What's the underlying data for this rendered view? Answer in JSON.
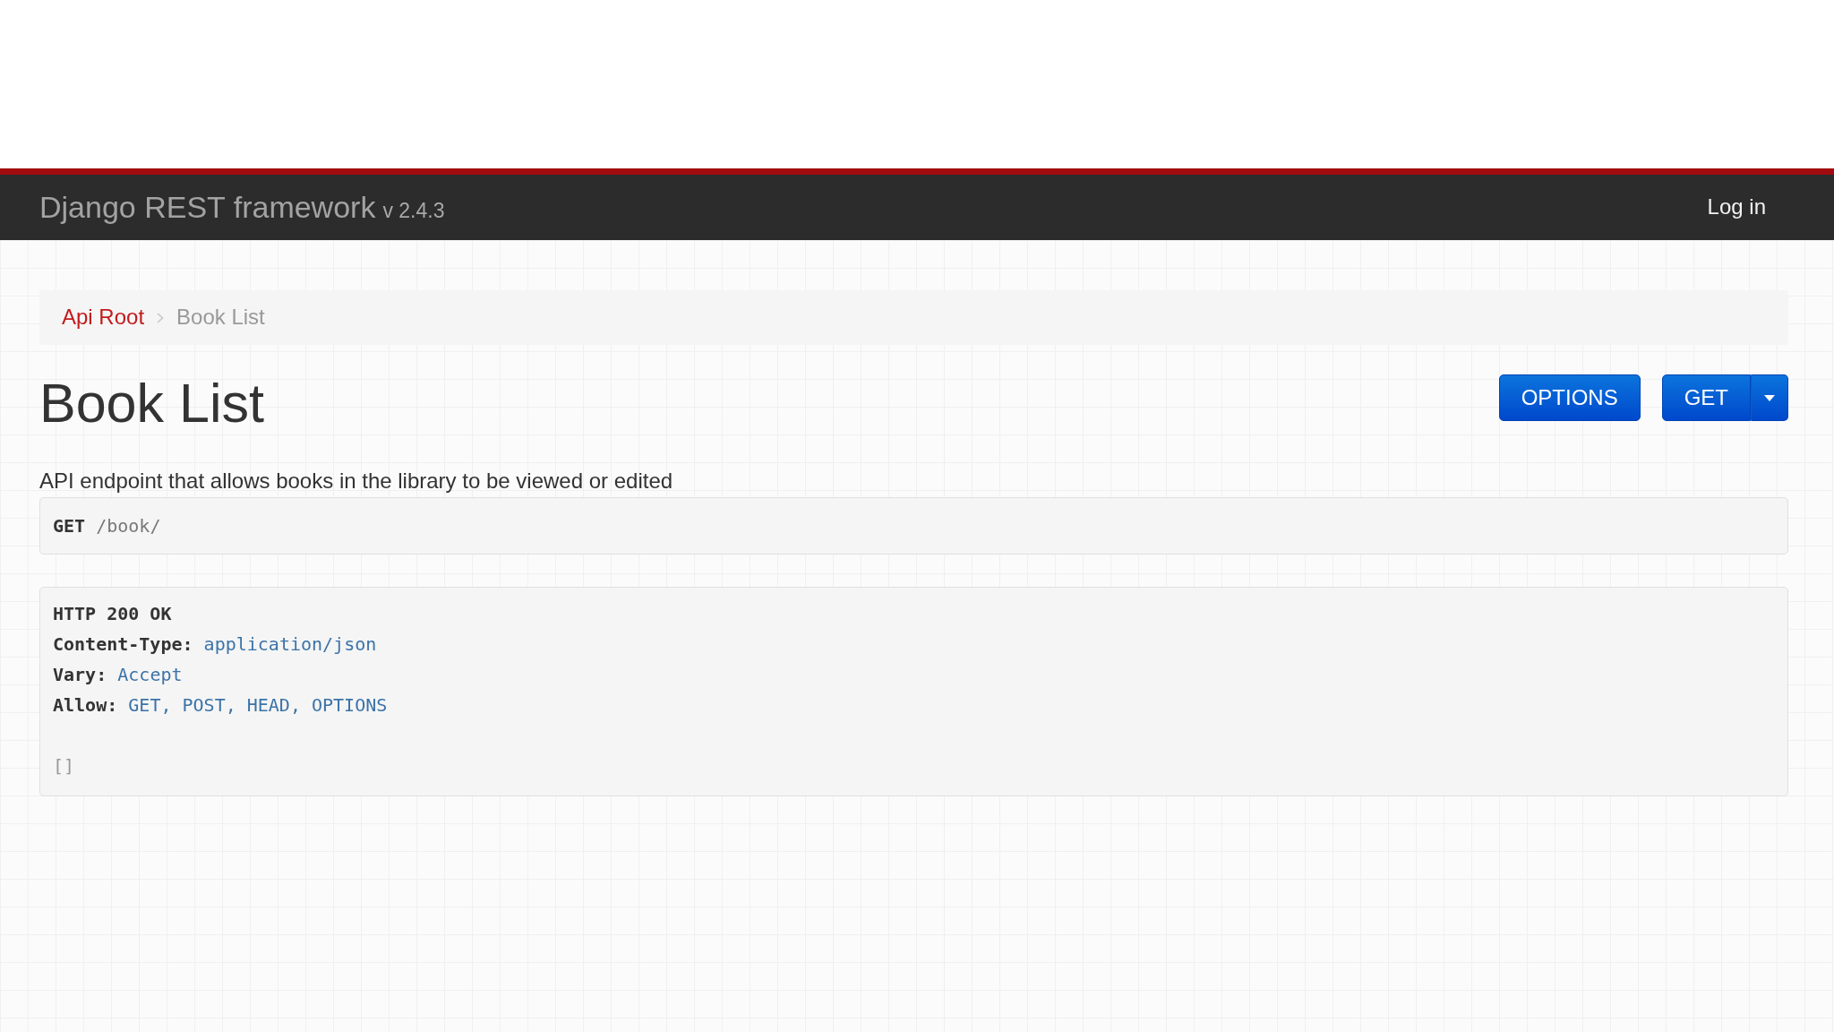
{
  "navbar": {
    "brand": "Django REST framework",
    "version": "v 2.4.3",
    "login_link": "Log in"
  },
  "breadcrumb": [
    {
      "label": "Api Root",
      "current": false
    },
    {
      "label": "Book List",
      "current": true
    }
  ],
  "page": {
    "title": "Book List",
    "description": "API endpoint that allows books in the library to be viewed or edited"
  },
  "actions": [
    {
      "label": "OPTIONS",
      "kind": "button"
    },
    {
      "label": "GET",
      "kind": "split"
    }
  ],
  "request": {
    "method": "GET",
    "path": "/book/"
  },
  "response": {
    "status": "HTTP 200 OK",
    "headers": [
      {
        "name": "Content-Type:",
        "value": "application/json"
      },
      {
        "name": "Vary:",
        "value": "Accept"
      },
      {
        "name": "Allow:",
        "value": "GET, POST, HEAD, OPTIONS"
      }
    ],
    "body": "[]"
  }
}
